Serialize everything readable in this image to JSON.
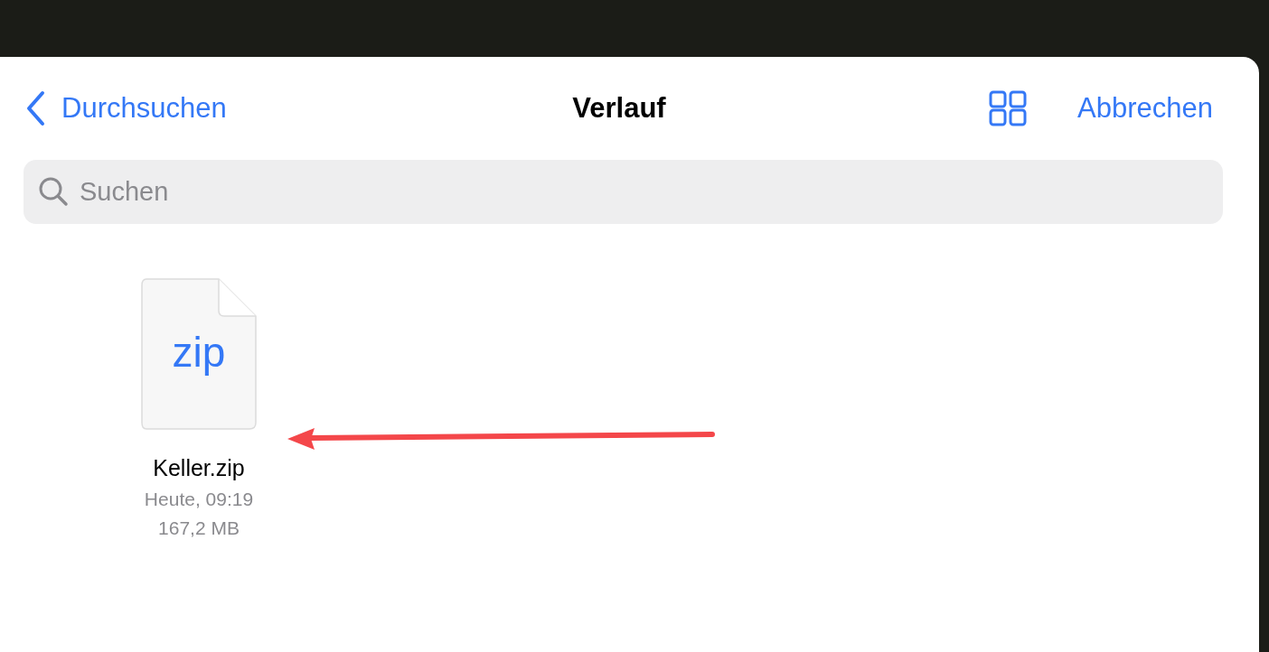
{
  "nav": {
    "back": "Durchsuchen",
    "title": "Verlauf",
    "cancel": "Abbrechen"
  },
  "search": {
    "placeholder": "Suchen"
  },
  "files": [
    {
      "kind": "zip",
      "badge": "zip",
      "name": "Keller.zip",
      "date": "Heute, 09:19",
      "size": "167,2 MB"
    }
  ],
  "annotation": {
    "kind": "arrow"
  }
}
